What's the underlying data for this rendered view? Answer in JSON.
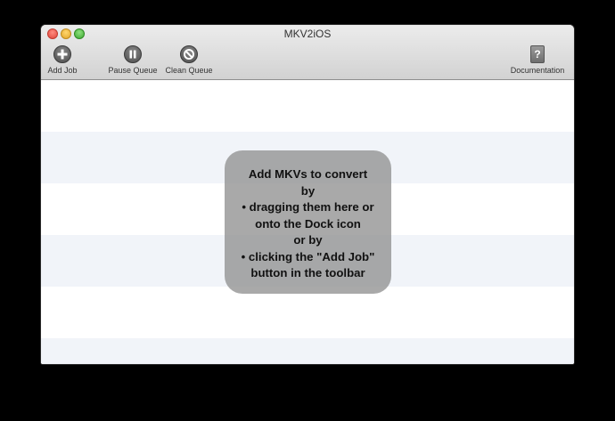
{
  "window": {
    "title": "MKV2iOS"
  },
  "toolbar": {
    "add_job": {
      "label": "Add Job",
      "icon": "plus-circle-icon"
    },
    "pause_queue": {
      "label": "Pause Queue",
      "icon": "pause-circle-icon"
    },
    "clean_queue": {
      "label": "Clean Queue",
      "icon": "prohibited-circle-icon"
    },
    "documentation": {
      "label": "Documentation",
      "icon": "help-book-icon"
    }
  },
  "hint": {
    "lines": [
      "Add MKVs to convert",
      "by",
      "• dragging them here or",
      "onto the Dock icon",
      "or by",
      "• clicking the \"Add Job\"",
      "button in the toolbar"
    ]
  },
  "colors": {
    "row_stripe": "#f1f4f9",
    "hint_panel": "#919191"
  }
}
